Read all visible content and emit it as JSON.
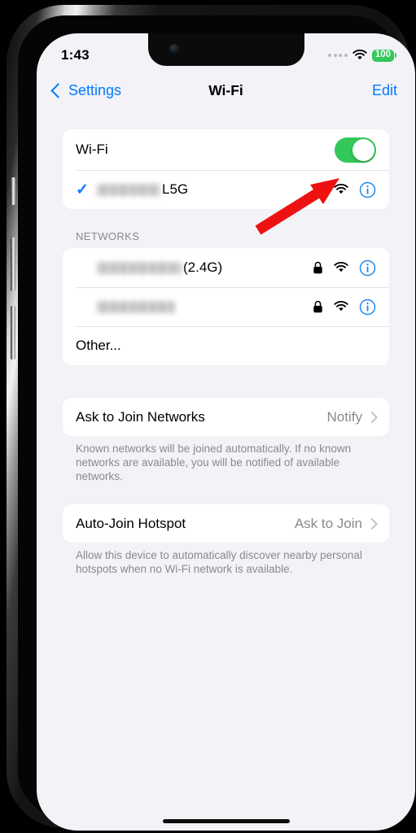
{
  "status_bar": {
    "time": "1:43",
    "battery_level": "100",
    "battery_color": "#34C759",
    "signal_icon": "cellular-dots-icon",
    "wifi_icon": "wifi-icon"
  },
  "nav_bar": {
    "back_label": "Settings",
    "title": "Wi-Fi",
    "edit_label": "Edit",
    "accent_color": "#007AFF"
  },
  "wifi_section": {
    "toggle_label": "Wi-Fi",
    "toggle_on": true,
    "toggle_on_color": "#34C759",
    "connected_network": {
      "ssid_visible_text": "L5G",
      "ssid_blurred": true,
      "checkmark": "✓",
      "lock_icon": "lock-icon",
      "signal_icon": "wifi-icon",
      "info_icon": "info-circle-icon"
    }
  },
  "networks_section": {
    "header": "NETWORKS",
    "items": [
      {
        "ssid_visible_text": "(2.4G)",
        "ssid_blurred": true,
        "blur_width": 104,
        "lock_icon": "lock-icon",
        "signal_icon": "wifi-icon",
        "info_icon": "info-circle-icon"
      },
      {
        "ssid_visible_text": "",
        "ssid_blurred": true,
        "blur_width": 96,
        "lock_icon": "lock-icon",
        "signal_icon": "wifi-icon",
        "info_icon": "info-circle-icon"
      }
    ],
    "other_label": "Other..."
  },
  "ask_to_join": {
    "label": "Ask to Join Networks",
    "value": "Notify",
    "footnote": "Known networks will be joined automatically. If no known networks are available, you will be notified of available networks."
  },
  "auto_join_hotspot": {
    "label": "Auto-Join Hotspot",
    "value": "Ask to Join",
    "footnote": "Allow this device to automatically discover nearby personal hotspots when no Wi-Fi network is available."
  },
  "annotation": {
    "type": "arrow",
    "color": "#EE1111",
    "points_to": "wifi-toggle"
  }
}
